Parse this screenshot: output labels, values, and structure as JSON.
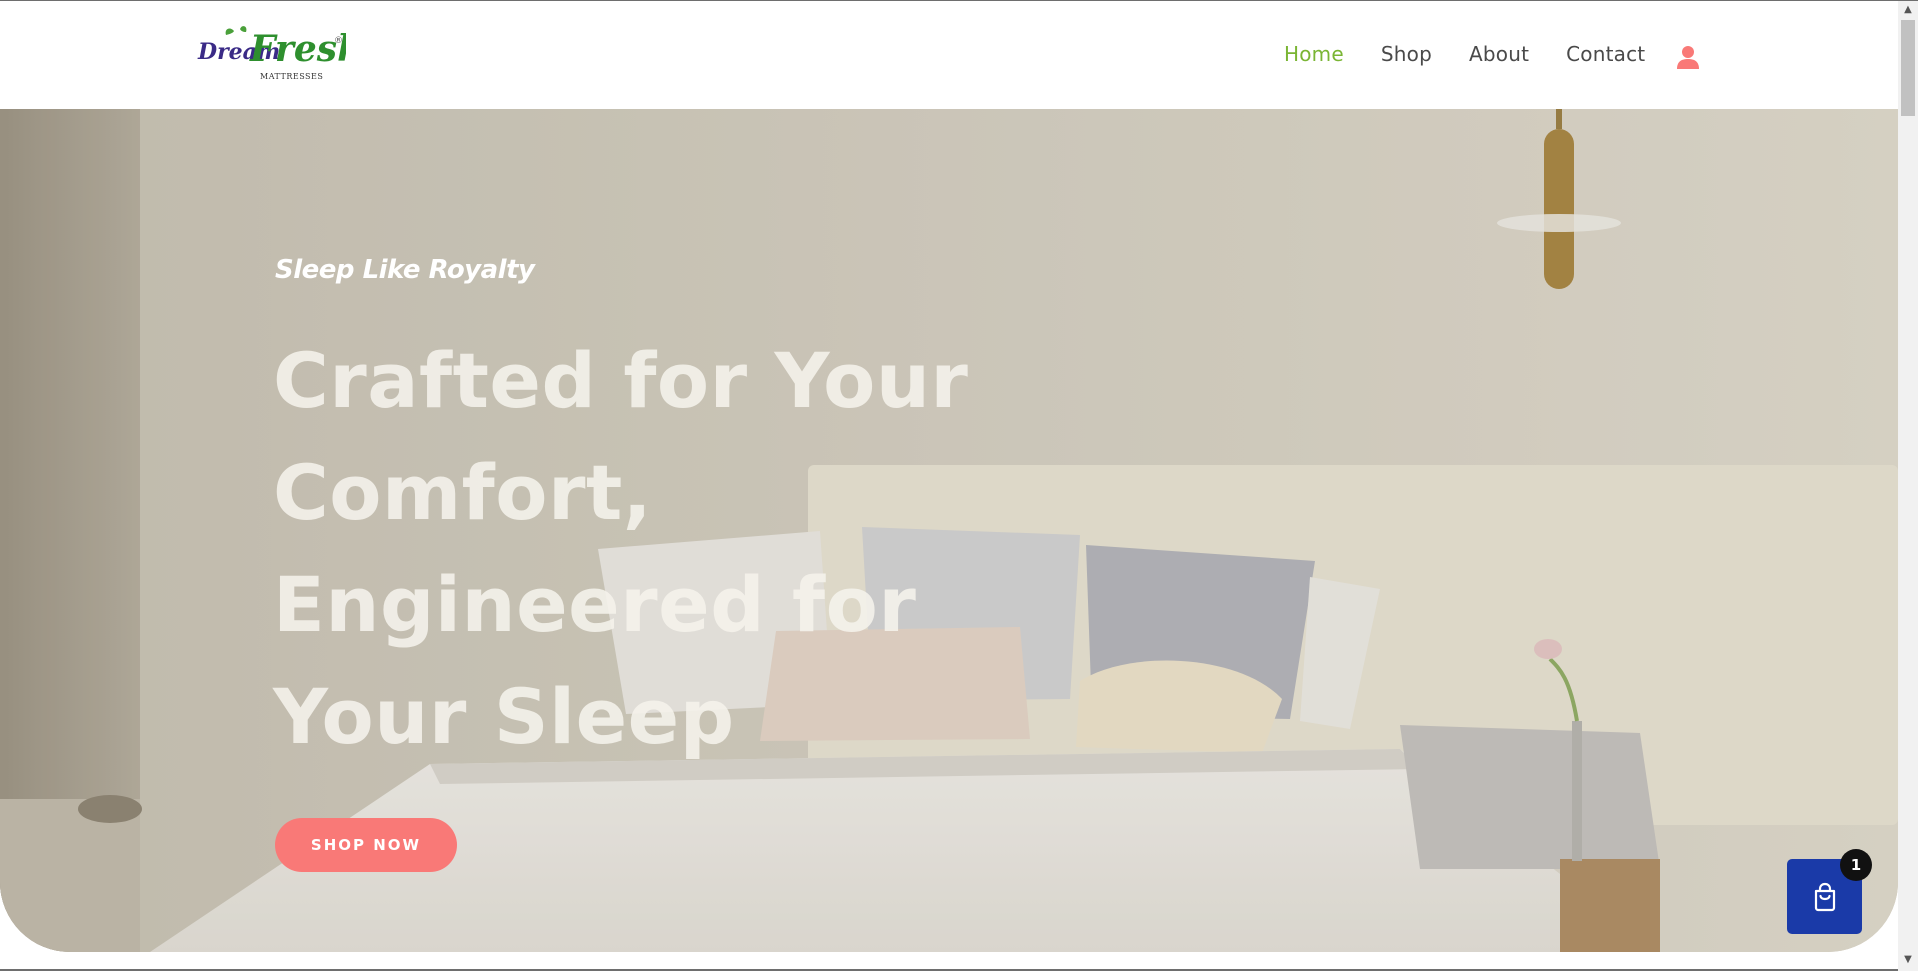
{
  "brand": {
    "logo_word_1": "Dream",
    "logo_word_2": "Fresh",
    "logo_tagline": "MATTRESSES",
    "logo_reg": "®"
  },
  "nav": {
    "items": [
      {
        "label": "Home",
        "active": true
      },
      {
        "label": "Shop",
        "active": false
      },
      {
        "label": "About",
        "active": false
      },
      {
        "label": "Contact",
        "active": false
      }
    ],
    "user_icon": "user-icon"
  },
  "hero": {
    "kicker": "Sleep Like Royalty",
    "headline_lines": [
      "Crafted for Your",
      "Comfort,",
      "Engineered for",
      "Your Sleep"
    ],
    "cta_label": "SHOP NOW"
  },
  "cart": {
    "icon": "shopping-bag-icon",
    "count": "1"
  },
  "colors": {
    "accent_green": "#7ab534",
    "cta_coral": "#f97977",
    "cart_blue": "#1a3aa8",
    "logo_purple": "#3a2a86"
  }
}
